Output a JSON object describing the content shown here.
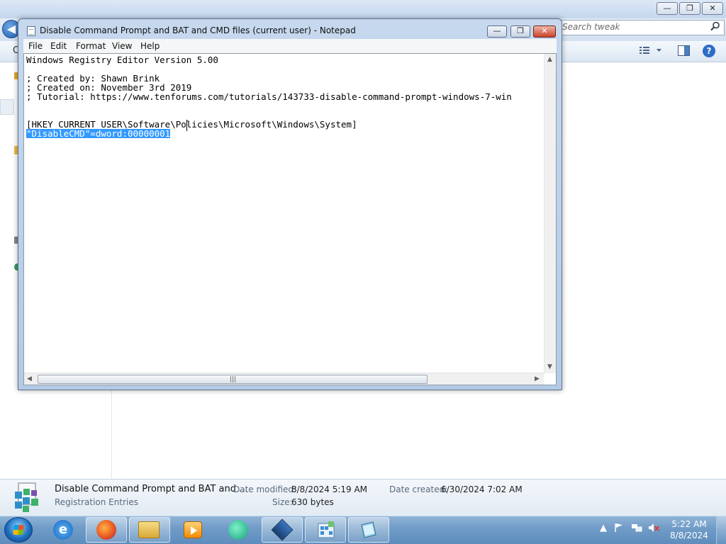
{
  "explorer": {
    "search_placeholder": "Search tweak",
    "caption_minimize": "—",
    "caption_restore": "❐",
    "caption_close": "✕",
    "back_glyph": "◀",
    "partial_left_char": "O",
    "details": {
      "file_name": "Disable Command Prompt and BAT and ...",
      "file_type": "Registration Entries",
      "date_modified_label": "Date modified:",
      "date_modified_value": "8/8/2024 5:19 AM",
      "size_label": "Size:",
      "size_value": "630 bytes",
      "date_created_label": "Date created:",
      "date_created_value": "6/30/2024 7:02 AM"
    }
  },
  "notepad": {
    "title": "Disable Command Prompt and BAT and CMD files (current user) - Notepad",
    "menu": [
      "File",
      "Edit",
      "Format",
      "View",
      "Help"
    ],
    "lines": [
      "Windows Registry Editor Version 5.00",
      "",
      "; Created by: Shawn Brink",
      "; Created on: November 3rd 2019",
      "; Tutorial: https://www.tenforums.com/tutorials/143733-disable-command-prompt-windows-7-win",
      "",
      "",
      "[HKEY_CURRENT_USER\\Software\\Policies\\Microsoft\\Windows\\System]"
    ],
    "selected_line": "\"DisableCMD\"=dword:00000001"
  },
  "taskbar": {
    "apps": [
      {
        "name": "Internet Explorer",
        "icon": "ie-icon",
        "color": "#1e88e5"
      },
      {
        "name": "Firefox",
        "icon": "firefox-icon",
        "color": "#e8501f"
      },
      {
        "name": "Windows Explorer",
        "icon": "folder-icon",
        "color": "#e8c04a"
      },
      {
        "name": "Media Player",
        "icon": "media-player-icon",
        "color": "#f08a00"
      },
      {
        "name": "Chat app",
        "icon": "chat-bubble-icon",
        "color": "#1bb58c"
      },
      {
        "name": "VirtualBox",
        "icon": "virtualbox-icon",
        "color": "#1e4f8a"
      },
      {
        "name": "Registry file",
        "icon": "registry-icon",
        "color": "#3f8fd3"
      },
      {
        "name": "Notepad",
        "icon": "notepad-icon",
        "color": "#5bb3d6"
      }
    ],
    "clock_time": "5:22 AM",
    "clock_date": "8/8/2024"
  }
}
